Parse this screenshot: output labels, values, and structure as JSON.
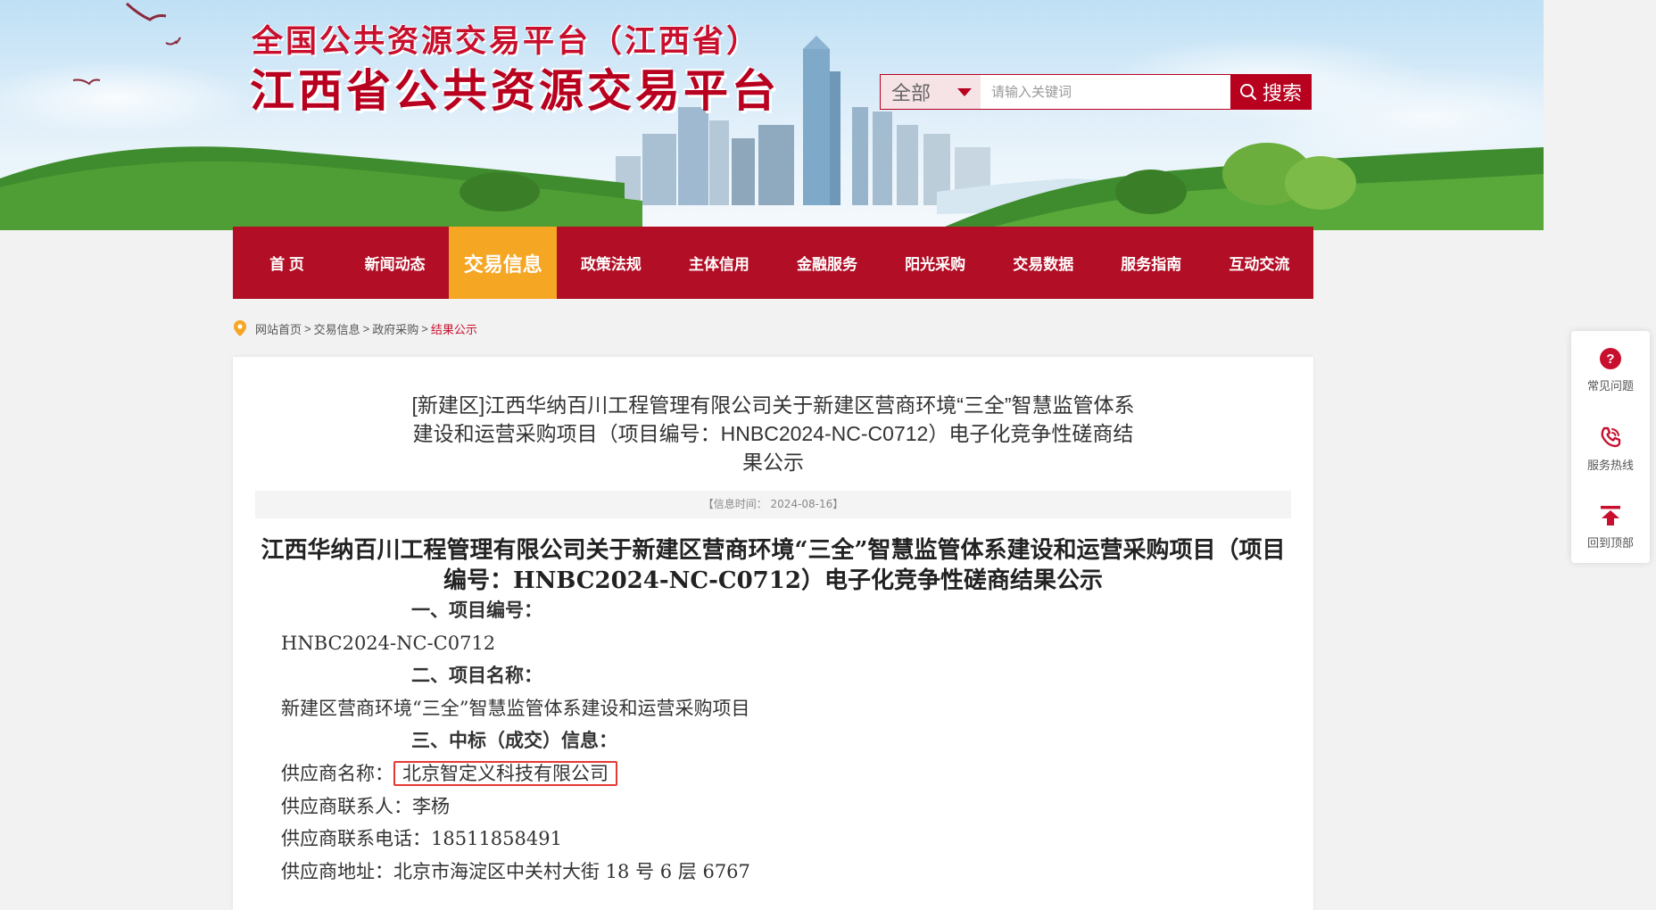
{
  "header": {
    "title_small": "全国公共资源交易平台（江西省）",
    "title_big": "江西省公共资源交易平台",
    "search": {
      "scope": "全部",
      "placeholder": "请输入关键词",
      "button": "搜索"
    }
  },
  "nav": {
    "items": [
      {
        "label": "首 页"
      },
      {
        "label": "新闻动态"
      },
      {
        "label": "交易信息",
        "active": true
      },
      {
        "label": "政策法规"
      },
      {
        "label": "主体信用"
      },
      {
        "label": "金融服务"
      },
      {
        "label": "阳光采购"
      },
      {
        "label": "交易数据"
      },
      {
        "label": "服务指南"
      },
      {
        "label": "互动交流"
      }
    ]
  },
  "breadcrumb": {
    "items": [
      "网站首页",
      "交易信息",
      "政府采购"
    ],
    "separator": ">",
    "current": "结果公示"
  },
  "article": {
    "doc_title": "[新建区]江西华纳百川工程管理有限公司关于新建区营商环境“三全”智慧监管体系建设和运营采购项目（项目编号：HNBC2024-NC-C0712）电子化竞争性磋商结果公示",
    "info_time": "【信息时间： 2024-08-16】",
    "title": "江西华纳百川工程管理有限公司关于新建区营商环境“三全”智慧监管体系建设和运营采购项目（项目编号：HNBC2024-NC-C0712）电子化竞争性磋商结果公示",
    "sections": {
      "s1_heading": "一、项目编号：",
      "s1_value": "HNBC2024-NC-C0712",
      "s2_heading": "二、项目名称：",
      "s2_value": "新建区营商环境“三全”智慧监管体系建设和运营采购项目",
      "s3_heading": "三、中标（成交）信息："
    },
    "supplier": {
      "name_label": "供应商名称：",
      "name_value": "北京智定义科技有限公司",
      "contact_label": "供应商联系人：",
      "contact_value": "李杨",
      "phone_label": "供应商联系电话：",
      "phone_value": "18511858491",
      "address_label": "供应商地址：",
      "address_value": "北京市海淀区中关村大街 18 号 6 层 6767"
    }
  },
  "sidebar": {
    "items": [
      {
        "label": "常见问题",
        "icon": "question-icon"
      },
      {
        "label": "服务热线",
        "icon": "phone-icon"
      },
      {
        "label": "回到顶部",
        "icon": "back-to-top-icon"
      }
    ]
  },
  "colors": {
    "brand_red": "#b20e25",
    "active_orange": "#f5a623",
    "highlight_box": "#e53935"
  }
}
